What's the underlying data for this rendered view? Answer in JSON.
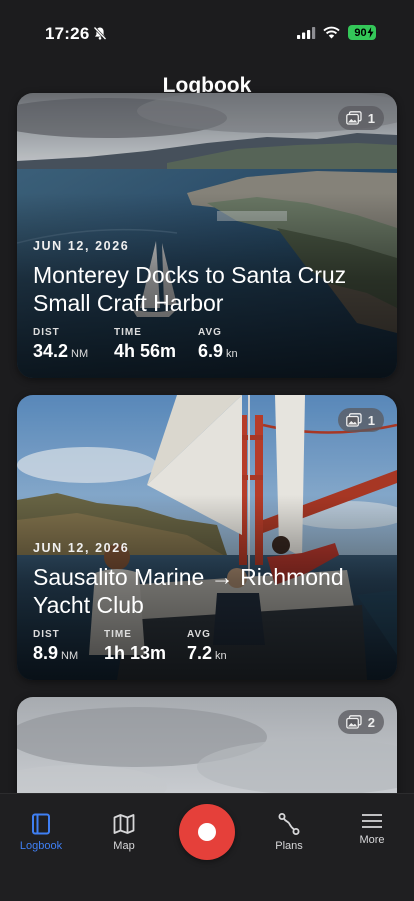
{
  "status_bar": {
    "time": "17:26",
    "battery": "90"
  },
  "page": {
    "title": "Logbook"
  },
  "trips": [
    {
      "date": "JUN 12, 2026",
      "title_line1": "Monterey Docks to Santa Cruz",
      "title_line2": "Small Craft Harbor",
      "photo_count": "1",
      "stats": [
        {
          "label": "DIST",
          "value": "34.2",
          "unit": "NM"
        },
        {
          "label": "TIME",
          "value": "4h 56m",
          "unit": ""
        },
        {
          "label": "AVG",
          "value": "6.9",
          "unit": "kn"
        }
      ]
    },
    {
      "date": "JUN 12, 2026",
      "title_line1": "Sausalito Marine → Richmond",
      "title_line2": "Yacht Club",
      "photo_count": "1",
      "stats": [
        {
          "label": "DIST",
          "value": "8.9",
          "unit": "NM"
        },
        {
          "label": "TIME",
          "value": "1h 13m",
          "unit": ""
        },
        {
          "label": "AVG",
          "value": "7.2",
          "unit": "kn"
        }
      ]
    },
    {
      "photo_count": "2"
    }
  ],
  "tab_bar": {
    "logbook": "Logbook",
    "map": "Map",
    "plans": "Plans",
    "more": "More"
  },
  "colors": {
    "accent": "#3f7ff3",
    "record": "#e5403a",
    "battery": "#34c759"
  }
}
